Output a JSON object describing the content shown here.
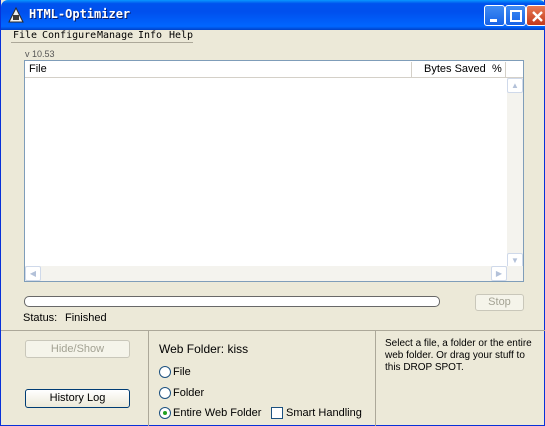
{
  "window": {
    "title": "HTML-Optimizer",
    "icon": "html-optimizer-app-icon",
    "controls": [
      "minimize",
      "maximize",
      "close"
    ]
  },
  "menu": {
    "items": [
      {
        "label": "File"
      },
      {
        "label": "Configure"
      },
      {
        "label": "Manage"
      },
      {
        "label": "Info"
      },
      {
        "label": "Help"
      }
    ]
  },
  "version": "v 10.53",
  "list": {
    "columns": [
      {
        "label": "File"
      },
      {
        "label": "Bytes Saved"
      },
      {
        "label": "%"
      }
    ],
    "rows": []
  },
  "progress": {
    "value_percent": 0
  },
  "stop_label": "Stop",
  "status": {
    "label": "Status:",
    "value": "Finished"
  },
  "buttons": {
    "hide_show": "Hide/Show",
    "history_log": "History Log"
  },
  "web_folder": {
    "label": "Web Folder: kiss"
  },
  "scope": {
    "options": [
      {
        "label": "File",
        "checked": false
      },
      {
        "label": "Folder",
        "checked": false
      },
      {
        "label": "Entire Web Folder",
        "checked": true
      }
    ]
  },
  "smart_handling": {
    "label": "Smart Handling",
    "checked": false
  },
  "hint": "Select a file, a folder or the entire web folder. Or drag your stuff to this DROP SPOT."
}
